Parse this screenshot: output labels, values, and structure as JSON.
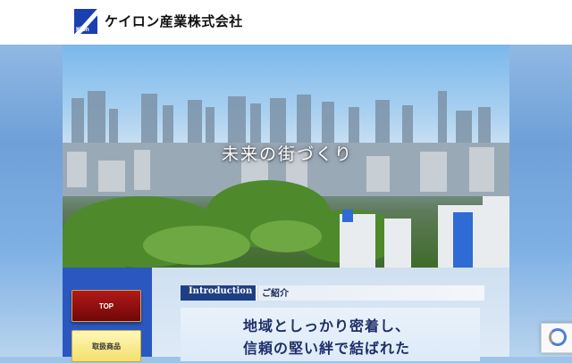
{
  "header": {
    "company_name": "ケイロン産業株式会社",
    "logo_text": "Klon"
  },
  "hero": {
    "title": "未来の街づくり"
  },
  "nav": {
    "items": [
      {
        "label": "TOP"
      },
      {
        "label": "取扱商品"
      }
    ]
  },
  "intro": {
    "heading_en": "Introduction",
    "heading_ja": "ご紹介",
    "feature_line1": "地域としっかり密着し、",
    "feature_line2": "信頼の堅い絆で結ばれた"
  },
  "colors": {
    "header_bg": "#ffffff",
    "brand_blue": "#1a3fb0",
    "top_button": "#a01414",
    "products_button": "#f3df6e",
    "intro_bar": "#1f3f85"
  }
}
